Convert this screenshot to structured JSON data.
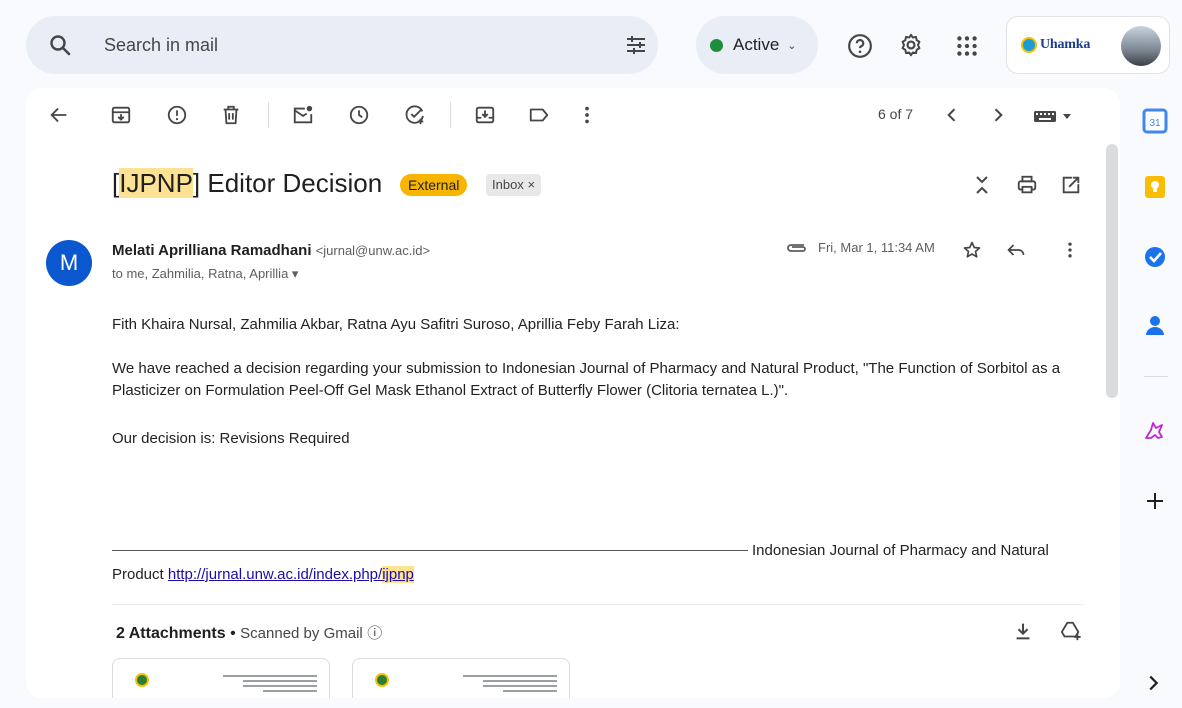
{
  "search": {
    "placeholder": "Search in mail"
  },
  "status": {
    "label": "Active",
    "color": "#1e8e3e"
  },
  "account": {
    "brand": "Uhamka"
  },
  "toolbar": {
    "pager": "6 of 7"
  },
  "message": {
    "subject_prefix": "[",
    "subject_highlight": "IJPNP",
    "subject_rest": "] Editor Decision",
    "badge_external": "External",
    "badge_inbox": "Inbox",
    "sender_name": "Melati Aprilliana Ramadhani",
    "sender_email": "<jurnal@unw.ac.id>",
    "avatar_letter": "M",
    "recipients": "to me, Zahmilia, Ratna, Aprillia",
    "date": "Fri, Mar 1, 11:34 AM",
    "body": {
      "greeting": "Fith Khaira Nursal, Zahmilia Akbar, Ratna Ayu Safitri Suroso, Aprillia Feby Farah Liza:",
      "paragraph": "We have reached a decision regarding your submission to Indonesian Journal of Pharmacy and Natural Product, \"The Function of Sorbitol as a Plasticizer on Formulation Peel-Off Gel Mask Ethanol Extract of Butterfly Flower (Clitoria ternatea L.)\".",
      "decision": "Our decision is: Revisions Required"
    },
    "signature": {
      "journal": "Indonesian Journal of Pharmacy and Natural",
      "product": "Product",
      "link_main": "http://jurnal.unw.ac.id/index.php/",
      "link_highlight": "ijpnp"
    }
  },
  "attachments": {
    "title": "2 Attachments",
    "separator": "•",
    "scan": "Scanned by Gmail"
  },
  "side_panel": {
    "calendar_day": "31"
  }
}
